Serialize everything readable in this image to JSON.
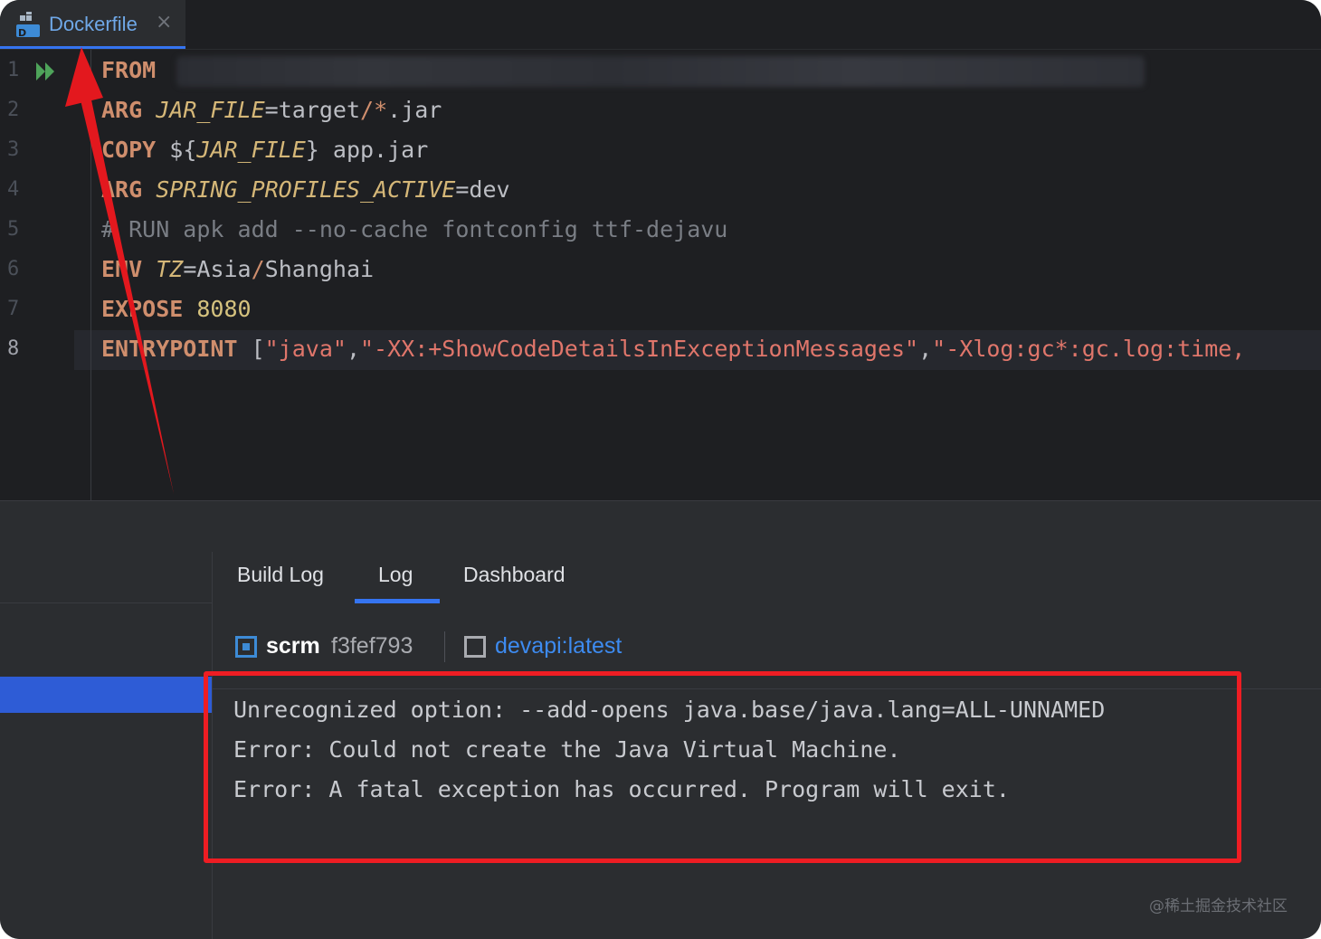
{
  "tab": {
    "label": "Dockerfile",
    "icon": "dockerfile-icon",
    "close_glyph": "×"
  },
  "editor": {
    "line_numbers": [
      "1",
      "2",
      "3",
      "4",
      "5",
      "6",
      "7",
      "8"
    ],
    "lines": [
      {
        "kw": "FROM",
        "rest": ""
      },
      {
        "kw": "ARG",
        "var": "JAR_FILE",
        "op": "=",
        "val": "target",
        "slash": "/",
        "glob": "*",
        "tail": ".jar"
      },
      {
        "kw": "COPY",
        "pre": " ${",
        "var": "JAR_FILE",
        "post": "} app.jar"
      },
      {
        "kw": "ARG",
        "var": "SPRING_PROFILES_ACTIVE",
        "op": "=",
        "val": "dev"
      },
      {
        "comment": "# RUN apk add --no-cache fontconfig ttf-dejavu"
      },
      {
        "kw": "ENV",
        "var": "TZ",
        "op": "=",
        "val": "Asia",
        "slash": "/",
        "tail": "Shanghai"
      },
      {
        "kw": "EXPOSE",
        "num": "8080"
      },
      {
        "kw": "ENTRYPOINT",
        "pre": " [",
        "s1": "\"java\"",
        "c1": ",",
        "s2": "\"-XX:+ShowCodeDetailsInExceptionMessages\"",
        "c2": ",",
        "s3": "\"-Xlog:gc*:gc.log:time,"
      }
    ]
  },
  "bottom_panel": {
    "tabs": [
      "Build Log",
      "Log",
      "Dashboard"
    ],
    "active_tab": "Log",
    "container": {
      "name": "scrm",
      "id": "f3fef793",
      "image": "devapi:latest"
    },
    "log_lines": [
      "Unrecognized option: --add-opens java.base/java.lang=ALL-UNNAMED",
      "Error: Could not create the Java Virtual Machine.",
      "Error: A fatal exception has occurred. Program will exit."
    ]
  },
  "watermark": "@稀土掘金技术社区",
  "colors": {
    "accent": "#3574f0",
    "annotation": "#ee1d23",
    "keyword": "#cf8e6d",
    "variable": "#d5b778",
    "string": "#e0766b"
  }
}
